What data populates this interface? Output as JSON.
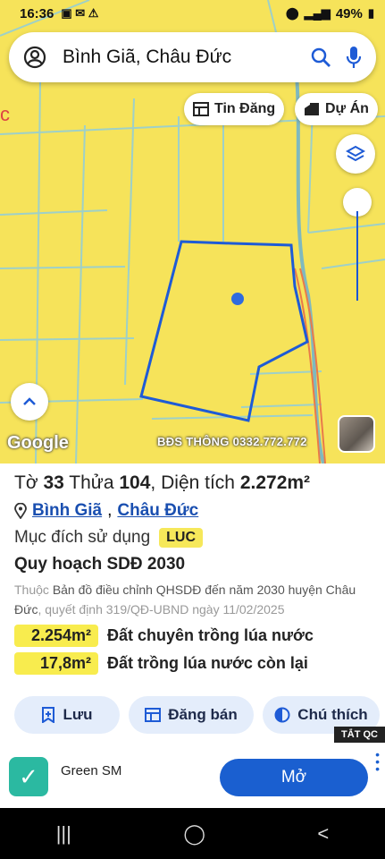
{
  "status_bar": {
    "time": "16:36",
    "battery": "49%"
  },
  "search": {
    "query": "Bình Giã, Châu Đức"
  },
  "chips": {
    "listing": "Tin Đăng",
    "project": "Dự Án"
  },
  "map": {
    "google_label": "Google",
    "watermark": "BĐS THÔNG 0332.772.772"
  },
  "parcel": {
    "to_label": "Tờ",
    "to_value": "33",
    "thua_label": "Thửa",
    "thua_value": "104",
    "area_label": "Diện tích",
    "area_value": "2.272m²",
    "commune": "Bình Giã",
    "separator": ",",
    "district": "Châu Đức",
    "purpose_label": "Mục đích sử dụng",
    "purpose_code": "LUC",
    "plan_title": "Quy hoạch SDĐ 2030",
    "note_prefix": "Thuộc",
    "note_map": "Bản đồ điều chỉnh QHSDĐ đến năm 2030 huyện Châu Đức",
    "note_suffix": ", quyết định 319/QĐ-UBND ngày 11/02/2025",
    "areas": [
      {
        "value": "2.254m²",
        "label": "Đất chuyên trồng lúa nước"
      },
      {
        "value": "17,8m²",
        "label": "Đất trồng lúa nước còn lại"
      }
    ]
  },
  "actions": {
    "save": "Lưu",
    "post": "Đăng bán",
    "legend": "Chú thích"
  },
  "ad": {
    "hide": "TẮT QC",
    "brand": "Green SM",
    "cta": "Mở"
  },
  "colors": {
    "map_yellow": "#f6e35a",
    "parcel_blue": "#1e5bd6",
    "accent_blue": "#1a5fd0"
  }
}
